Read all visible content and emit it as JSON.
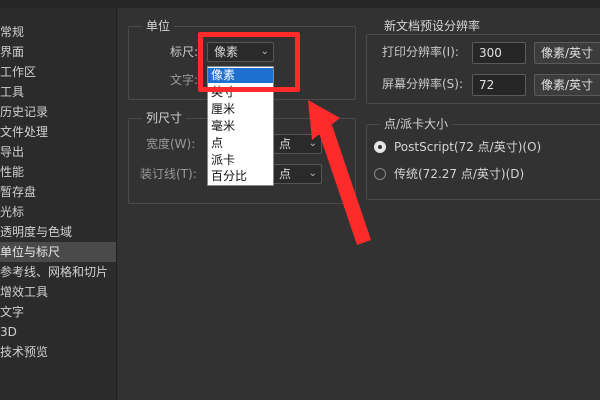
{
  "sidebar": {
    "items": [
      {
        "label": "常规"
      },
      {
        "label": "界面"
      },
      {
        "label": "工作区"
      },
      {
        "label": "工具"
      },
      {
        "label": "历史记录"
      },
      {
        "label": "文件处理"
      },
      {
        "label": "导出"
      },
      {
        "label": "性能"
      },
      {
        "label": "暂存盘"
      },
      {
        "label": "光标"
      },
      {
        "label": "透明度与色域"
      },
      {
        "label": "单位与标尺",
        "active": true
      },
      {
        "label": "参考线、网格和切片"
      },
      {
        "label": "增效工具"
      },
      {
        "label": "文字"
      },
      {
        "label": "3D"
      },
      {
        "label": "技术预览"
      }
    ]
  },
  "units_group": {
    "title": "单位",
    "ruler_label": "标尺:",
    "ruler_value": "像素",
    "type_label": "文字:"
  },
  "dropdown": {
    "options": [
      "像素",
      "英寸",
      "厘米",
      "毫米",
      "点",
      "派卡",
      "百分比"
    ],
    "selected_index": 0
  },
  "column_group": {
    "title": "列尺寸",
    "width_label": "宽度(W):",
    "width_unit": "点",
    "gutter_label": "装订线(T):",
    "gutter_unit": "点"
  },
  "resolution_group": {
    "title": "新文档预设分辨率",
    "print_label": "打印分辨率(I):",
    "print_value": "300",
    "print_unit": "像素/英寸",
    "screen_label": "屏幕分辨率(S):",
    "screen_value": "72",
    "screen_unit": "像素/英寸"
  },
  "point_group": {
    "title": "点/派卡大小",
    "opt1": "PostScript(72 点/英寸)(O)",
    "opt2": "传统(72.27 点/英寸)(D)",
    "selected": "opt1"
  },
  "colors": {
    "highlight": "#ff2b2b",
    "selected_option": "#1e6fd0"
  }
}
